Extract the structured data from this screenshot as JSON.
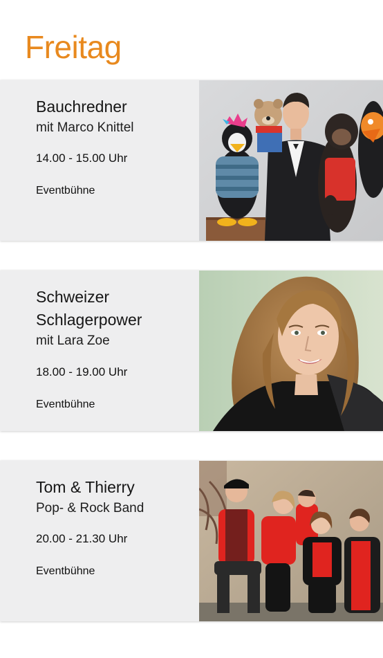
{
  "day": {
    "title": "Freitag"
  },
  "colors": {
    "accent": "#e8891e",
    "card_background": "#eeeeef",
    "text": "#161616"
  },
  "events": [
    {
      "title_line1": "Bauchredner",
      "title_line2": "",
      "subtitle": "mit Marco Knittel",
      "time": "14.00 - 15.00 Uhr",
      "venue": "Eventbühne",
      "photo": "ventriloquist-with-puppets-photo"
    },
    {
      "title_line1": "Schweizer",
      "title_line2": "Schlagerpower",
      "subtitle": "mit Lara Zoe",
      "time": "18.00 - 19.00 Uhr",
      "venue": "Eventbühne",
      "photo": "singer-portrait-photo"
    },
    {
      "title_line1": "Tom & Thierry",
      "title_line2": "",
      "subtitle": "Pop- & Rock Band",
      "time": "20.00 - 21.30 Uhr",
      "venue": "Eventbühne",
      "photo": "band-group-photo"
    }
  ]
}
